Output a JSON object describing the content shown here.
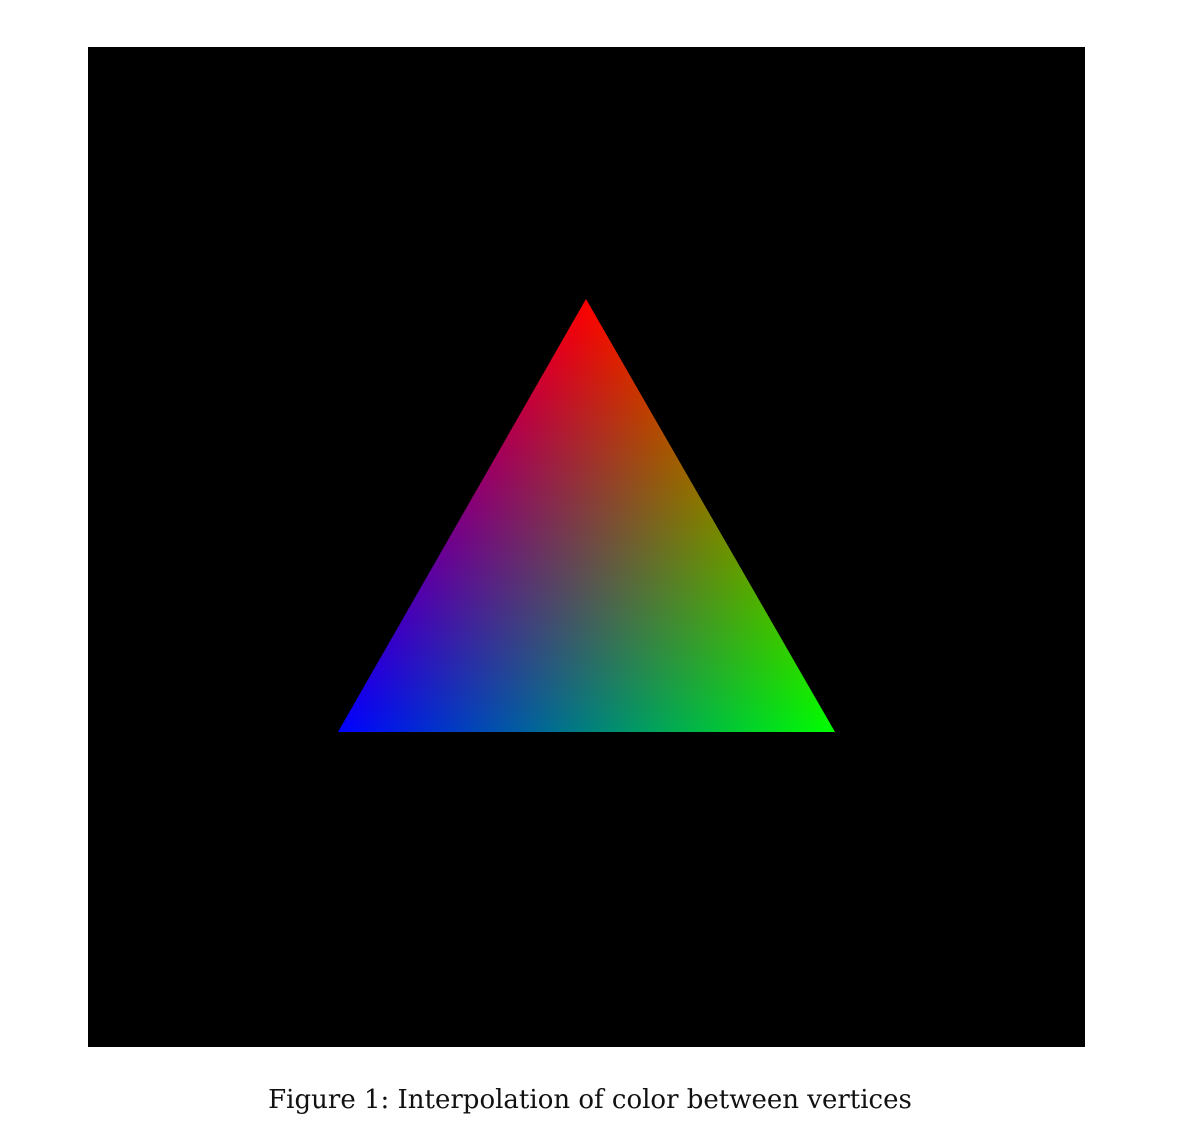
{
  "figure": {
    "caption": "Figure 1: Interpolation of color between vertices",
    "background_color": "#000000",
    "vertex_colors": {
      "top": "#ff0000",
      "bottom_left": "#0000ff",
      "bottom_right": "#00ff00"
    }
  }
}
